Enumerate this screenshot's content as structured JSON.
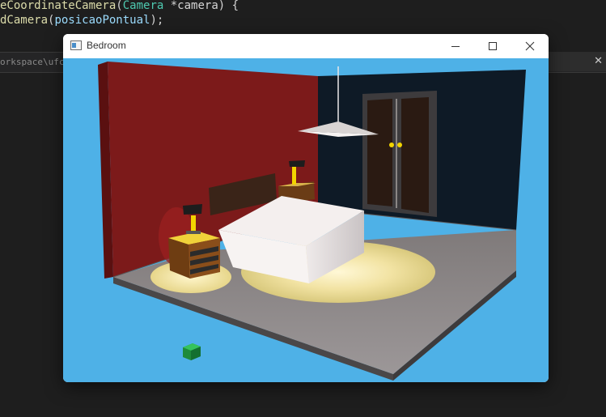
{
  "editor": {
    "line1": {
      "fn": "eCoordinateCamera",
      "open": "(",
      "type": "Camera",
      "rest": " *camera) {"
    },
    "line2": {
      "fn": "dCamera",
      "open": "(",
      "arg": "posicaoPontual",
      "close": ");"
    },
    "terminal_path": "orkspace\\ufc\\c"
  },
  "window": {
    "title": "Bedroom",
    "controls": [
      "minimize",
      "maximize",
      "close"
    ]
  },
  "scene": {
    "description_icons": [
      "app-window-icon"
    ],
    "colors": {
      "sky": "#4eb1e7",
      "red_wall": "#7c1a1a",
      "dark_wall": "#0e1a26",
      "floor": "#8d8889",
      "bedspread": "#f4efee",
      "lamp_light": "#f5e6a6"
    }
  }
}
